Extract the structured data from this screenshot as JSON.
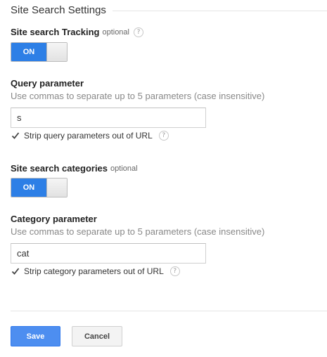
{
  "section": {
    "title": "Site Search Settings"
  },
  "tracking": {
    "label": "Site search Tracking",
    "optional": "optional",
    "help": "?",
    "toggle_label": "ON"
  },
  "query": {
    "label": "Query parameter",
    "hint": "Use commas to separate up to 5 parameters (case insensitive)",
    "value": "s",
    "strip_label": "Strip query parameters out of URL",
    "strip_checked": true,
    "help": "?"
  },
  "categories": {
    "label": "Site search categories",
    "optional": "optional",
    "toggle_label": "ON"
  },
  "category": {
    "label": "Category parameter",
    "hint": "Use commas to separate up to 5 parameters (case insensitive)",
    "value": "cat",
    "strip_label": "Strip category parameters out of URL",
    "strip_checked": true,
    "help": "?"
  },
  "actions": {
    "save": "Save",
    "cancel": "Cancel"
  },
  "colors": {
    "accent": "#2d7fe6",
    "save_button": "#4d8ef0"
  }
}
